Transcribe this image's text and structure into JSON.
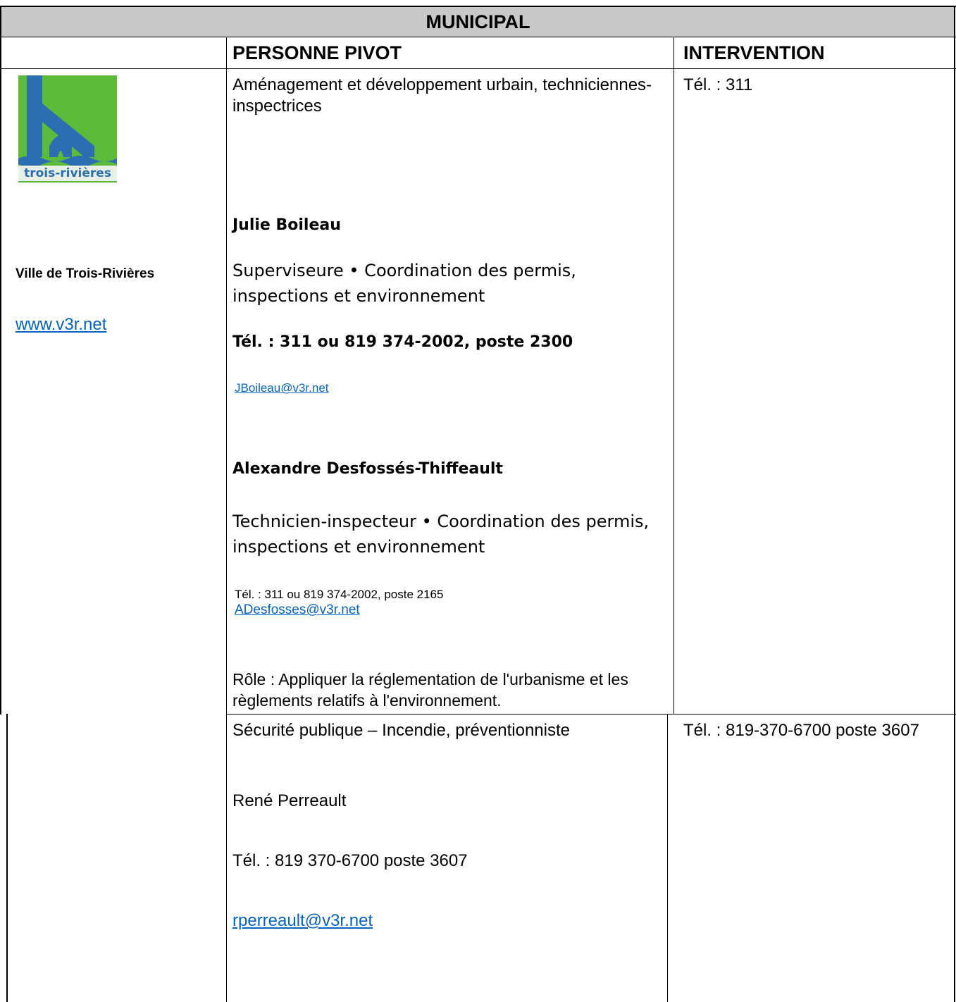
{
  "header": {
    "title": "MUNICIPAL"
  },
  "columns": {
    "contact": "PERSONNE PIVOT",
    "intervention": "INTERVENTION"
  },
  "organization": {
    "logo_text": "trois-rivières",
    "name": "Ville de Trois-Rivières",
    "website": "www.v3r.net",
    "logo_colors": {
      "background": "#5dbb3c",
      "mark": "#2b6fb2"
    }
  },
  "section1": {
    "department": "Aménagement et développement urbain, techniciennes-inspectrices",
    "person1": {
      "name": "Julie Boileau",
      "title": "Superviseure • Coordination des permis, inspections et environnement",
      "phone": "Tél. : 311 ou 819 374-2002, poste 2300",
      "email": "JBoileau@v3r.net"
    },
    "person2": {
      "name": "Alexandre Desfossés-Thiffeault",
      "title": "Technicien-inspecteur • Coordination des permis, inspections et environnement",
      "phone": "Tél. : 311 ou 819 374-2002, poste 2165",
      "email": "ADesfosses@v3r.net"
    },
    "role": "Rôle : Appliquer la réglementation de l'urbanisme et les règlements relatifs à l'environnement.",
    "intervention": "Tél. : 311"
  },
  "section2": {
    "department": "Sécurité publique – Incendie, préventionniste",
    "name": "René Perreault",
    "phone": "Tél. : 819 370-6700 poste 3607",
    "email": "rperreault@v3r.net",
    "intervention": "Tél. : 819-370-6700 poste 3607"
  }
}
